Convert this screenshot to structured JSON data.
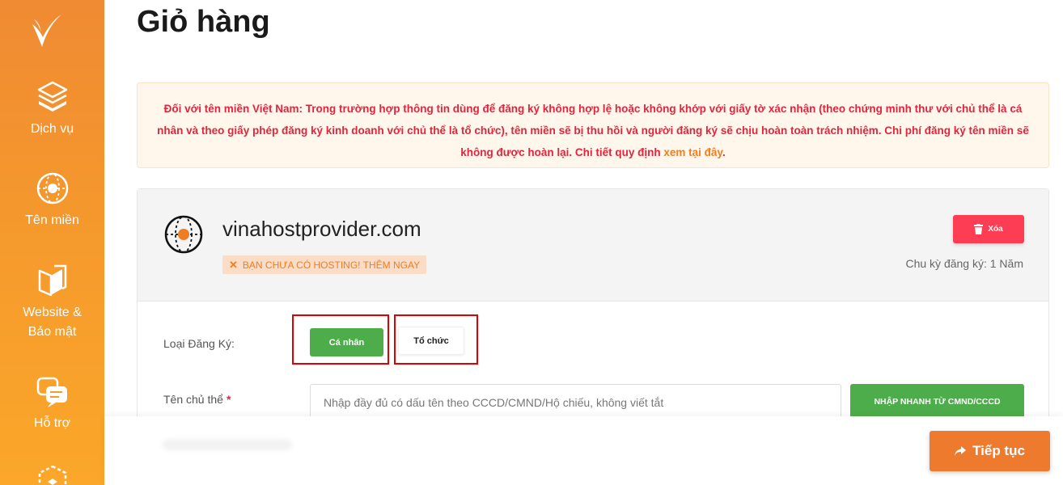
{
  "page": {
    "title": "Giỏ hàng"
  },
  "sidebar": {
    "logo_icon": "v-logo-icon",
    "items": [
      {
        "label": "Dịch vụ",
        "icon": "layers-icon"
      },
      {
        "label": "Tên miền",
        "icon": "globe-icon"
      },
      {
        "label_line1": "Website &",
        "label_line2": "Bảo mật",
        "icon": "book-shield-icon"
      },
      {
        "label": "Hỗ trợ",
        "icon": "chat-icon"
      }
    ]
  },
  "notice": {
    "text": "Đối với tên miền Việt Nam: Trong trường hợp thông tin dùng để đăng ký không hợp lệ hoặc không khớp với giấy tờ xác nhận (theo chứng minh thư với chủ thể là cá nhân và theo giấy phép đăng ký kinh doanh với chủ thể là tổ chức), tên miền sẽ bị thu hồi và người đăng ký sẽ chịu hoàn toàn trách nhiệm. Chi phí đăng ký tên miền sẽ không được hoàn lại. Chi tiết quy định ",
    "link_text": "xem tại đây",
    "suffix": ".",
    "text_color": "#e0263d",
    "link_color": "#ef7d23"
  },
  "cart_item": {
    "domain": "vinahostprovider.com",
    "hosting_badge": "BẠN CHƯA CÓ HOSTING! THÊM NGAY",
    "delete_label": "Xóa",
    "cycle": "Chu kỳ đăng ký: 1 Năm"
  },
  "form": {
    "registration_type_label": "Loại Đăng Ký:",
    "type_personal": "Cá nhân",
    "type_organization": "Tổ chức",
    "owner_label": "Tên chủ thể",
    "required_mark": "*",
    "owner_placeholder": "Nhập đầy đủ có dấu tên theo CCCD/CMND/Hộ chiếu, không viết tắt",
    "owner_value": "",
    "quick_fill_label": "NHẬP NHANH TỪ CMND/CCCD"
  },
  "footer": {
    "next_label": "Tiếp tục"
  },
  "colors": {
    "brand_orange": "#ef7d23",
    "green": "#4ead4b",
    "danger": "#fc3d53",
    "highlight": "#e00000"
  }
}
